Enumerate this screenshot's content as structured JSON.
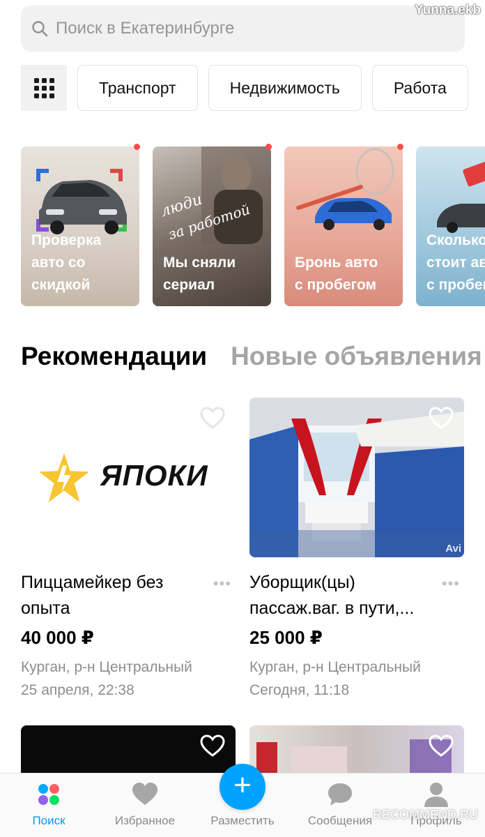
{
  "header": {
    "watermark_user": "Yunna.ekb",
    "search_placeholder": "Поиск в Екатеринбурге"
  },
  "categories": [
    "Транспорт",
    "Недвижимость",
    "Работа"
  ],
  "stories": [
    {
      "line1": "Проверка",
      "line2": "авто со",
      "line3": "скидкой"
    },
    {
      "line1": "",
      "line2": "Мы сняли",
      "line3": "сериал"
    },
    {
      "line1": "",
      "line2": "Бронь авто",
      "line3": "с пробегом"
    },
    {
      "line1": "Сколько",
      "line2": "стоит авто",
      "line3": "с пробегом"
    }
  ],
  "story2_handwriting": "люди за работой",
  "tabs": {
    "active": "Рекомендации",
    "inactive": "Новые объявления"
  },
  "listings": [
    {
      "brand": "ЯПОКИ",
      "title": "Пиццамейкер без опыта",
      "price": "40 000 ₽",
      "location": "Курган, р-н Центральный",
      "date": "25 апреля, 22:38"
    },
    {
      "title": "Уборщик(цы) пассаж.ваг. в пути,...",
      "price": "25 000 ₽",
      "location": "Курган, р-н Центральный",
      "date": "Сегодня, 11:18",
      "image_watermark": "Avi"
    }
  ],
  "nav": {
    "search": "Поиск",
    "favorites": "Избранное",
    "post": "Разместить",
    "messages": "Сообщения",
    "profile": "Профиль"
  },
  "watermark_bottom": "RECOMMEND.RU",
  "colors": {
    "accent": "#00a2ff",
    "active_nav": "#0099f7",
    "notification_dot": "#ff4b4b",
    "brand_star": "#f7c531"
  }
}
